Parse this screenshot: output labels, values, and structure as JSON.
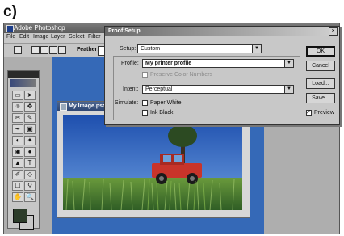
{
  "panel_label": "c)",
  "app": {
    "title": "Adobe Photoshop",
    "menus": [
      "File",
      "Edit",
      "Image",
      "Layer",
      "Select",
      "Filter"
    ],
    "options": {
      "feather_label": "Feather:"
    }
  },
  "document": {
    "title": "My Image.psd"
  },
  "dialog": {
    "title": "Proof Setup",
    "close_glyph": "×",
    "setup_label": "Setup:",
    "setup_value": "Custom",
    "profile_label": "Profile:",
    "profile_value": "My printer profile",
    "preserve_label": "Preserve Color Numbers",
    "intent_label": "Intent:",
    "intent_value": "Perceptual",
    "simulate_label": "Simulate:",
    "paper_white_label": "Paper White",
    "ink_black_label": "Ink Black",
    "preview_label": "Preview",
    "preview_checked": true,
    "buttons": {
      "ok": "OK",
      "cancel": "Cancel",
      "load": "Load...",
      "save": "Save..."
    },
    "dropdown_arrow": "▼"
  },
  "tools": [
    "▭",
    "➤",
    "⌾",
    "✥",
    "✂",
    "✎",
    "✒",
    "▣",
    "◐",
    "✦",
    "◉",
    "●",
    "▲",
    "T",
    "✐",
    "◇",
    "☐",
    "⚲",
    "✋",
    "🔍"
  ],
  "colors": {
    "workspace_blue": "#3569b7",
    "jeep_red": "#c8342a",
    "sky_blue": "#2f64c2",
    "grass_green": "#4f8a3a"
  }
}
